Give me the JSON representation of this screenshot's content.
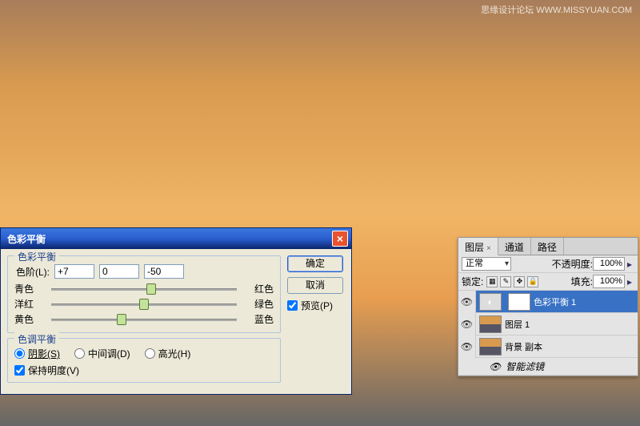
{
  "watermark": "思缘设计论坛  WWW.MISSYUAN.COM",
  "dialog": {
    "title": "色彩平衡",
    "group1": {
      "title": "色彩平衡",
      "levels_label": "色阶(L):",
      "val1": "+7",
      "val2": "0",
      "val3": "-50",
      "sliders": [
        {
          "left": "青色",
          "right": "红色",
          "pos": 54
        },
        {
          "left": "洋红",
          "right": "绿色",
          "pos": 50
        },
        {
          "left": "黄色",
          "right": "蓝色",
          "pos": 38
        }
      ]
    },
    "group2": {
      "title": "色调平衡",
      "radios": {
        "shadow": "阴影(S)",
        "mid": "中间调(D)",
        "high": "高光(H)"
      },
      "preserve": "保持明度(V)"
    },
    "buttons": {
      "ok": "确定",
      "cancel": "取消",
      "preview": "预览(P)"
    }
  },
  "panel": {
    "tabs": {
      "layers": "图层",
      "channels": "通道",
      "paths": "路径"
    },
    "blend_label": "正常",
    "opacity_label": "不透明度:",
    "opacity_value": "100%",
    "lock_label": "锁定:",
    "fill_label": "填充:",
    "fill_value": "100%",
    "layers": [
      {
        "name": "色彩平衡 1",
        "type": "adj"
      },
      {
        "name": "图层 1",
        "type": "img"
      },
      {
        "name": "背景 副本",
        "type": "img"
      }
    ],
    "smart": "智能滤镜"
  }
}
